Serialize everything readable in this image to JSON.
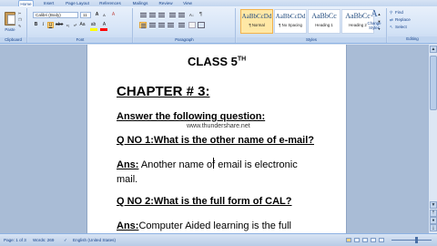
{
  "ribbon": {
    "tabs": [
      {
        "label": "Home",
        "active": true
      },
      {
        "label": "Insert",
        "active": false
      },
      {
        "label": "Page Layout",
        "active": false
      },
      {
        "label": "References",
        "active": false
      },
      {
        "label": "Mailings",
        "active": false
      },
      {
        "label": "Review",
        "active": false
      },
      {
        "label": "View",
        "active": false
      }
    ],
    "clipboard": {
      "paste_label": "Paste",
      "group_label": "Clipboard"
    },
    "font": {
      "name": "Calibri (Body)",
      "size": "11",
      "group_label": "Font"
    },
    "paragraph": {
      "group_label": "Paragraph"
    },
    "styles": {
      "items": [
        {
          "sample": "AaBbCcDd",
          "name": "¶ Normal",
          "selected": true
        },
        {
          "sample": "AaBbCcDd",
          "name": "¶ No Spacing",
          "selected": false
        },
        {
          "sample": "AaBbCc",
          "name": "Heading 1",
          "selected": false
        },
        {
          "sample": "AaBbCc",
          "name": "Heading 2",
          "selected": false
        }
      ],
      "change_styles": "Change Styles",
      "group_label": "Styles"
    },
    "editing": {
      "find": "Find",
      "replace": "Replace",
      "select": "Select",
      "group_label": "Editing"
    }
  },
  "document": {
    "title": "CLASS 5",
    "title_sup": "TH",
    "chapter": "CHAPTER # 3:",
    "instruction": "Answer the following question:",
    "watermark": "www.thundershare.net",
    "q1": "Q NO 1:What is the other name of e-mail?",
    "a1_label": "Ans:",
    "a1_line1": " Another name of email is electronic",
    "a1_line2": "mail.",
    "q2": "Q NO 2:What is the full form of CAL?",
    "a2_label": "Ans:",
    "a2_text": "Computer Aided learning is the full"
  },
  "status": {
    "page": "Page: 1 of 3",
    "words": "Words: 269",
    "language": "English (United States)"
  },
  "colors": {
    "accent": "#15428b",
    "ribbon": "#d7e5f7",
    "canvas": "#a9bcd6"
  }
}
